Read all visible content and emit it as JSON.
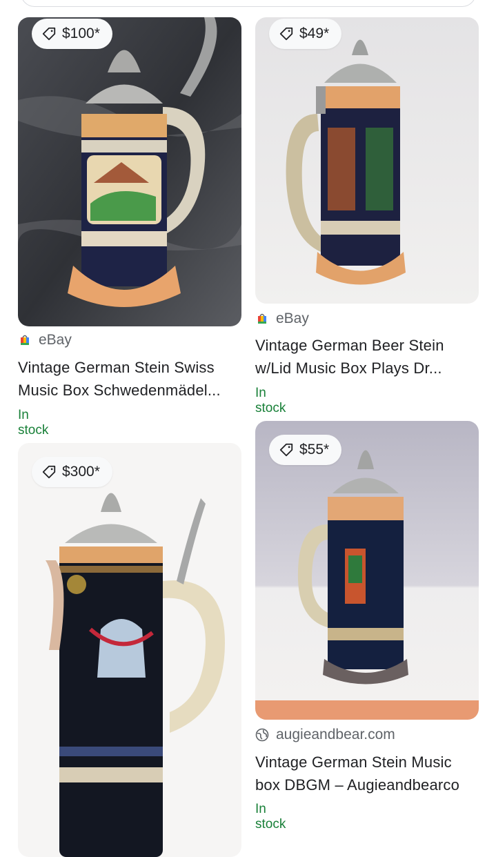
{
  "colors": {
    "in_stock": "#188038",
    "price_bg": "#f8f9fa",
    "text": "#202124",
    "muted": "#5f6368"
  },
  "products": [
    {
      "price": "$100*",
      "source": "eBay",
      "source_icon": "shopping-bag-icon",
      "title_line1": "Vintage German Stein Swiss",
      "title_line2": "Music Box Schwedenmädel...",
      "stock": "In stock"
    },
    {
      "price": "$49*",
      "source": "eBay",
      "source_icon": "shopping-bag-icon",
      "title_line1": "Vintage German Beer Stein",
      "title_line2": "w/Lid Music Box Plays Dr...",
      "stock": "In stock"
    },
    {
      "price": "$300*"
    },
    {
      "price": "$55*",
      "source": "augieandbear.com",
      "source_icon": "globe-icon",
      "title_line1": "Vintage German Stein Music",
      "title_line2": "box DBGM – Augieandbearco",
      "stock": "In stock"
    }
  ]
}
